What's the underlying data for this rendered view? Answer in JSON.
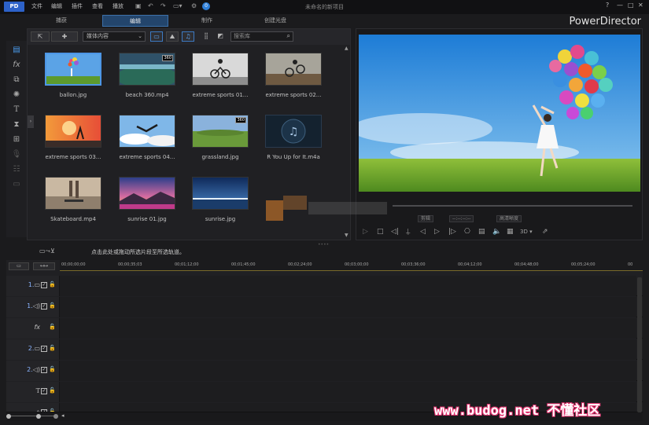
{
  "app": {
    "logo": "PD",
    "brand": "PowerDirector",
    "project_title": "未命名的新项目",
    "window_buttons": [
      "?",
      "—",
      "□",
      "✕"
    ]
  },
  "menu": [
    "文件",
    "编辑",
    "插件",
    "查看",
    "播放"
  ],
  "tabs": [
    {
      "label": "捕获",
      "active": false
    },
    {
      "label": "编辑",
      "active": true
    },
    {
      "label": "制作",
      "active": false
    },
    {
      "label": "创建光盘",
      "active": false
    }
  ],
  "library": {
    "dropdown": "媒体内容",
    "search_placeholder": "搜索库",
    "items": [
      {
        "caption": "ballon.jpg",
        "selected": true,
        "badge": ""
      },
      {
        "caption": "beach 360.mp4",
        "selected": false,
        "badge": "360"
      },
      {
        "caption": "extreme sports 01...",
        "selected": false,
        "badge": ""
      },
      {
        "caption": "extreme sports 02...",
        "selected": false,
        "badge": ""
      },
      {
        "caption": "extreme sports 03...",
        "selected": false,
        "badge": ""
      },
      {
        "caption": "extreme sports 04...",
        "selected": false,
        "badge": ""
      },
      {
        "caption": "grassland.jpg",
        "selected": false,
        "badge": "360"
      },
      {
        "caption": "R You Up for It.m4a",
        "selected": false,
        "badge": ""
      },
      {
        "caption": "Skateboard.mp4",
        "selected": false,
        "badge": ""
      },
      {
        "caption": "sunrise 01.jpg",
        "selected": false,
        "badge": ""
      },
      {
        "caption": "sunrise.jpg",
        "selected": false,
        "badge": ""
      }
    ]
  },
  "preview": {
    "mode_label": "剪辑",
    "timecode": "--:--:--:--",
    "quality_label": "高清晰度",
    "three_d_label": "3D"
  },
  "hint": "点击此处或拖动所选片段至所选轨道。",
  "timeline": {
    "ticks": [
      "00;00;00;00",
      "00;00;35;03",
      "00;01;12;00",
      "00;01;45;00",
      "00;02;24;00",
      "00;03;00;00",
      "00;03;36;00",
      "00;04;12;00",
      "00;04;48;00",
      "00;05;24;00",
      "00"
    ],
    "tracks": [
      {
        "num": "1.",
        "icon": "video-track-icon",
        "glyph": "▭"
      },
      {
        "num": "1.",
        "icon": "audio-track-icon",
        "glyph": "◁)"
      },
      {
        "num": "",
        "icon": "fx-track-icon",
        "glyph": "fx"
      },
      {
        "num": "2.",
        "icon": "video-track-icon",
        "glyph": "▭"
      },
      {
        "num": "2.",
        "icon": "audio-track-icon",
        "glyph": "◁)"
      },
      {
        "num": "",
        "icon": "title-track-icon",
        "glyph": "T"
      },
      {
        "num": "",
        "icon": "voice-track-icon",
        "glyph": "⌂"
      }
    ]
  },
  "watermark": "www.budog.net 不懂社区"
}
